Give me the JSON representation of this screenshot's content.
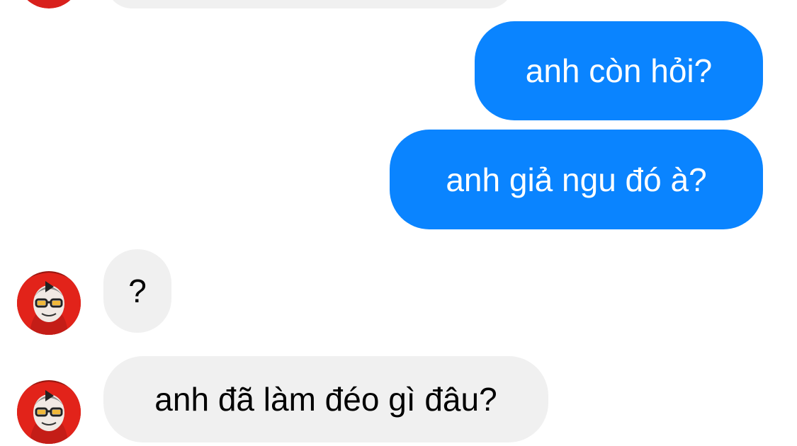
{
  "conversation": {
    "messages": [
      {
        "direction": "outgoing",
        "text": "anh còn hỏi?"
      },
      {
        "direction": "outgoing",
        "text": "anh giả ngu đó à?"
      },
      {
        "direction": "incoming",
        "text": "?"
      },
      {
        "direction": "incoming",
        "text": "anh đã làm đéo gì đâu?"
      }
    ],
    "colors": {
      "outgoing_bubble": "#0a84ff",
      "incoming_bubble": "#f0f0f0",
      "background": "#ffffff"
    }
  }
}
